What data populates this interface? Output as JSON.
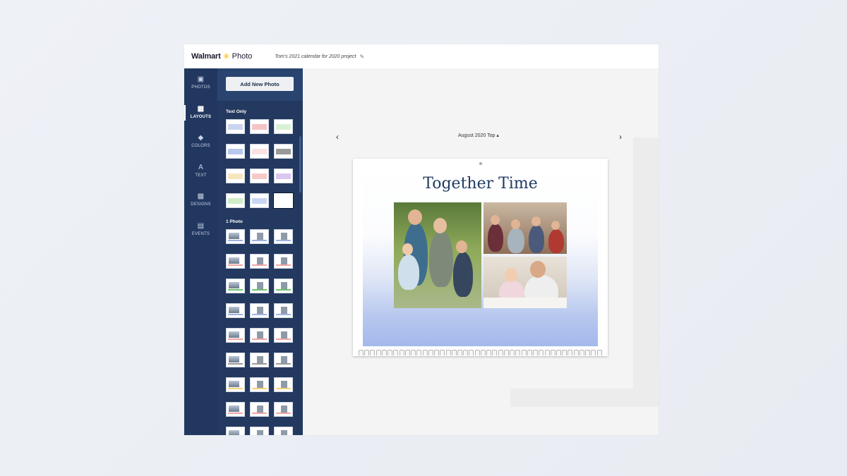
{
  "brand": {
    "name": "Walmart",
    "product": "Photo"
  },
  "project": {
    "title": "Tom's 2021 calendar for 2020 project"
  },
  "rail": [
    {
      "label": "PHOTOS",
      "icon": "photos-icon",
      "glyph": "▣"
    },
    {
      "label": "LAYOUTS",
      "icon": "layouts-icon",
      "glyph": "▦",
      "active": true
    },
    {
      "label": "COLORS",
      "icon": "paint-bucket-icon",
      "glyph": "◆"
    },
    {
      "label": "TEXT",
      "icon": "text-icon",
      "glyph": "A"
    },
    {
      "label": "DESIGNS",
      "icon": "designs-icon",
      "glyph": "▩"
    },
    {
      "label": "EVENTS",
      "icon": "events-icon",
      "glyph": "▤"
    }
  ],
  "panel": {
    "add_photo_label": "Add New Photo",
    "sections": [
      {
        "label": "Text Only"
      },
      {
        "label": "1 Photo"
      }
    ]
  },
  "canvas": {
    "month_label": "August 2020 Top",
    "calendar_title": "Together Time"
  },
  "colors": {
    "rail_bg": "#223760",
    "panel_bg": "#24395f",
    "title": "#1f3b63",
    "accent_spark": "#f5b400"
  }
}
